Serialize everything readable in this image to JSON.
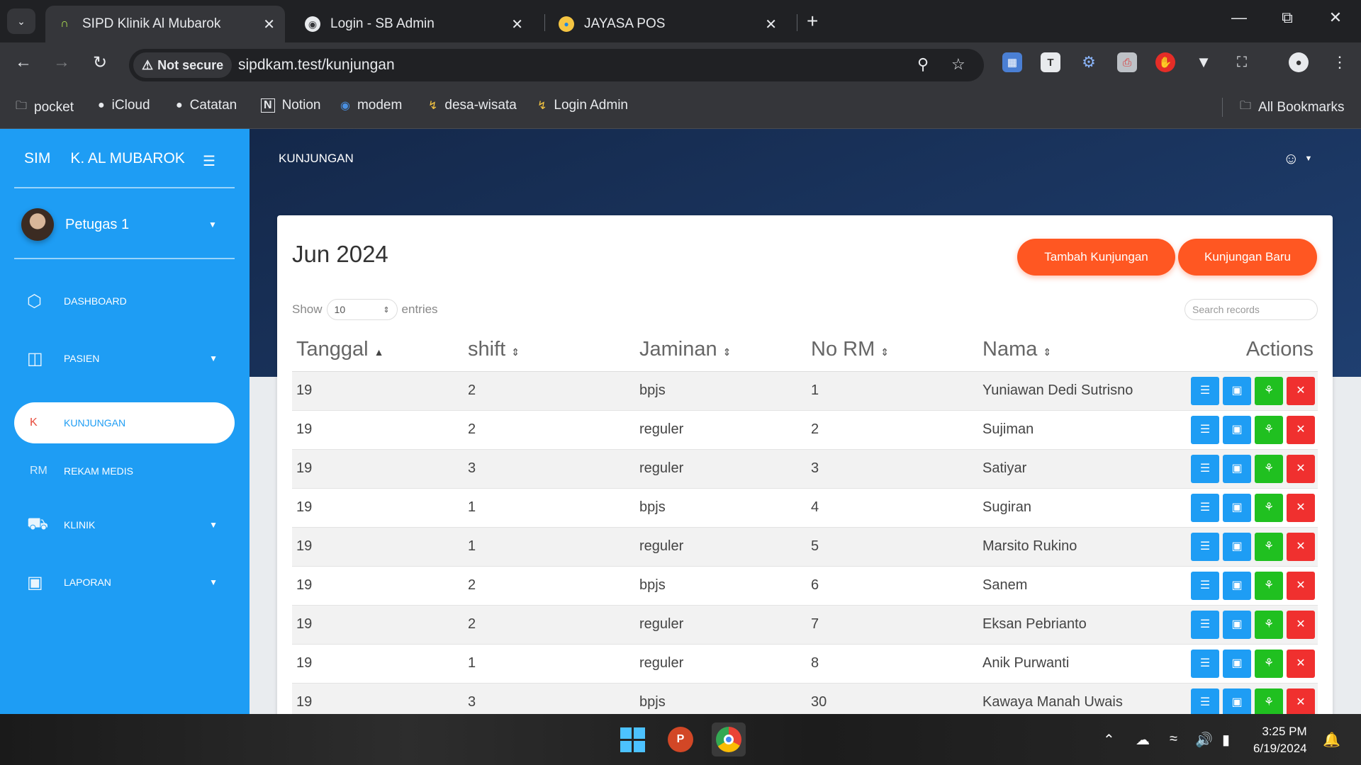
{
  "browser": {
    "tabs": [
      {
        "title": "SIPD Klinik Al Mubarok",
        "icon": "app-icon",
        "active": true
      },
      {
        "title": "Login - SB Admin",
        "icon": "globe-icon",
        "active": false
      },
      {
        "title": "JAYASA POS",
        "icon": "app-icon",
        "active": false
      }
    ],
    "security_label": "Not secure",
    "url": "sipdkam.test/kunjungan",
    "bookmarks": [
      "pocket",
      "iCloud",
      "Catatan",
      "Notion",
      "modem",
      "desa-wisata",
      "Login Admin"
    ],
    "all_bookmarks_label": "All Bookmarks"
  },
  "sidebar": {
    "brand_mini": "SIM",
    "brand_name": "K. AL MUBAROK",
    "user_name": "Petugas 1",
    "items": [
      {
        "label": "DASHBOARD",
        "icon": "box-icon"
      },
      {
        "label": "PASIEN",
        "icon": "building-icon"
      },
      {
        "label": "KUNJUNGAN",
        "mini": "K",
        "active": true
      },
      {
        "label": "REKAM MEDIS",
        "mini": "RM"
      },
      {
        "label": "KLINIK",
        "icon": "ambulance-icon"
      },
      {
        "label": "LAPORAN",
        "icon": "briefcase-icon"
      }
    ]
  },
  "header": {
    "page_title": "KUNJUNGAN"
  },
  "card": {
    "title": "Jun 2024",
    "btn_tambah": "Tambah Kunjungan",
    "btn_baru": "Kunjungan Baru",
    "show_label": "Show",
    "entries_label": "entries",
    "page_length": "10",
    "search_placeholder": "Search records"
  },
  "table": {
    "columns": [
      "Tanggal",
      "shift",
      "Jaminan",
      "No RM",
      "Nama",
      "Actions"
    ],
    "rows": [
      [
        "19",
        "2",
        "bpjs",
        "1",
        "Yuniawan Dedi Sutrisno"
      ],
      [
        "19",
        "2",
        "reguler",
        "2",
        "Sujiman"
      ],
      [
        "19",
        "3",
        "reguler",
        "3",
        "Satiyar"
      ],
      [
        "19",
        "1",
        "bpjs",
        "4",
        "Sugiran"
      ],
      [
        "19",
        "1",
        "reguler",
        "5",
        "Marsito Rukino"
      ],
      [
        "19",
        "2",
        "bpjs",
        "6",
        "Sanem"
      ],
      [
        "19",
        "2",
        "reguler",
        "7",
        "Eksan Pebrianto"
      ],
      [
        "19",
        "1",
        "reguler",
        "8",
        "Anik Purwanti"
      ],
      [
        "19",
        "3",
        "bpjs",
        "30",
        "Kawaya Manah Uwais"
      ]
    ]
  },
  "taskbar": {
    "time": "3:25 PM",
    "date": "6/19/2024"
  },
  "colors": {
    "sidebar": "#1e9df4",
    "accent_orange": "#ff5722",
    "btn_blue": "#1e9df4",
    "btn_green": "#20c020",
    "btn_red": "#f0302f"
  }
}
